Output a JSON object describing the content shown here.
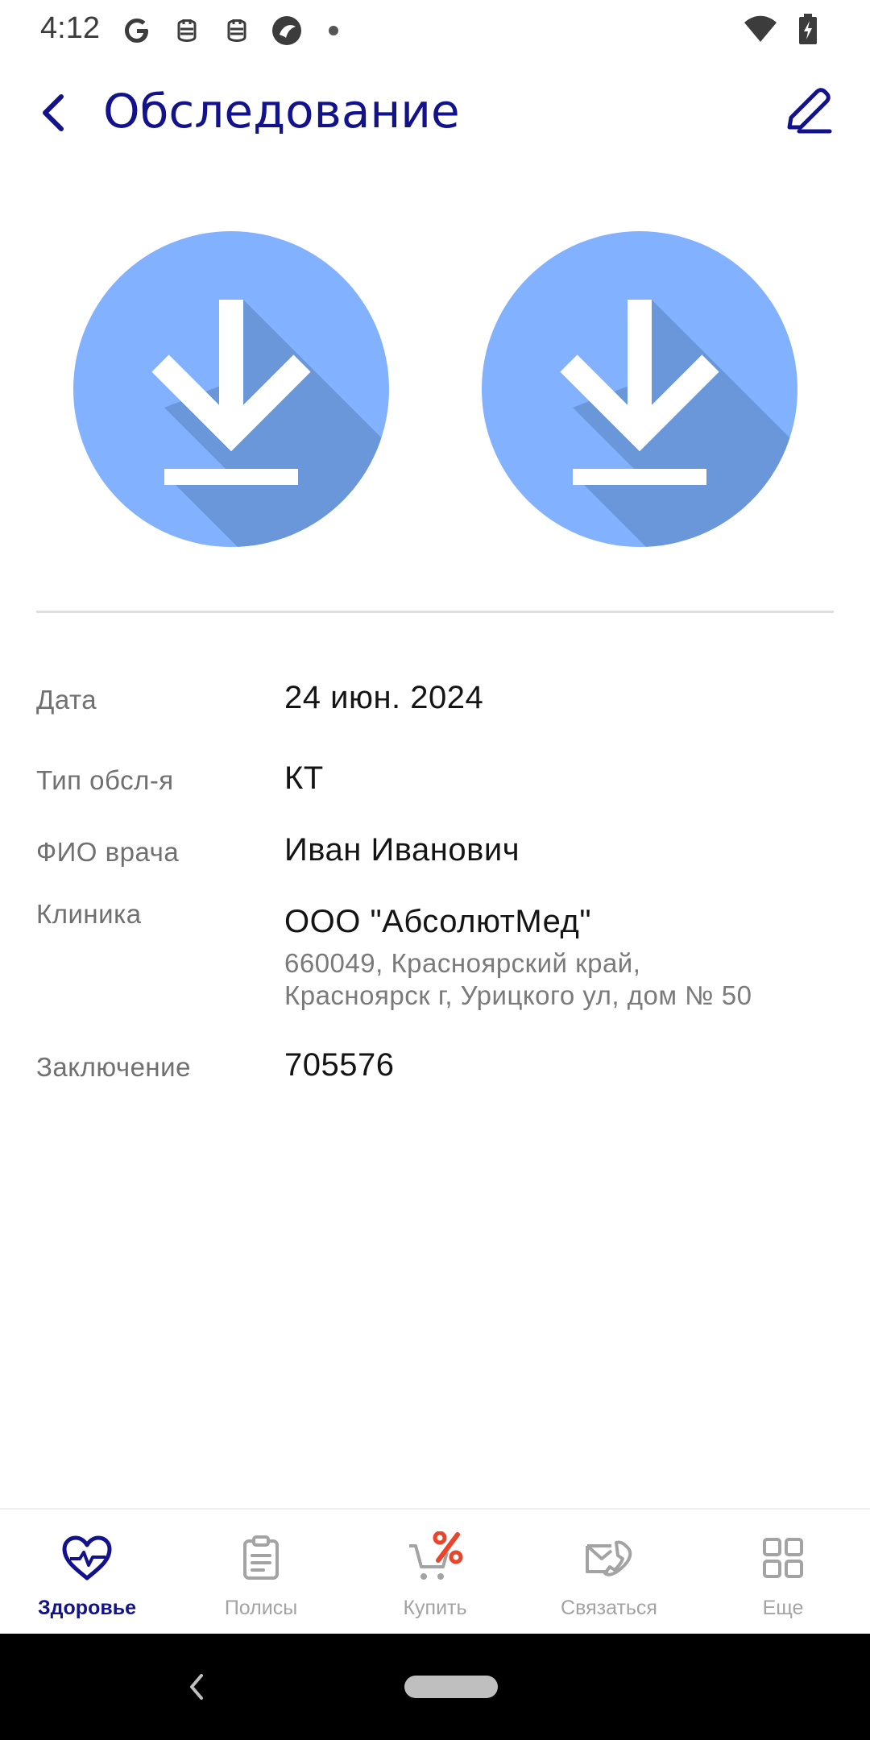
{
  "status_bar": {
    "time": "4:12",
    "left_icons": [
      "google-icon",
      "notification-icon",
      "notification-icon",
      "browser-icon",
      "dot-icon"
    ],
    "right_icons": [
      "wifi-icon",
      "battery-charging-icon"
    ]
  },
  "app_bar": {
    "title": "Обследование",
    "back_icon": "chevron-left-icon",
    "edit_icon": "pencil-icon"
  },
  "attachments": [
    {
      "icon": "download-icon",
      "color": "#82b1ff"
    },
    {
      "icon": "download-icon",
      "color": "#82b1ff"
    }
  ],
  "details": {
    "date": {
      "label": "Дата",
      "value": "24 июн. 2024"
    },
    "type": {
      "label": "Тип обсл-я",
      "value": "КТ"
    },
    "doctor": {
      "label": "ФИО врача",
      "value": "Иван Иванович"
    },
    "clinic": {
      "label": "Клиника",
      "name": "ООО \"АбсолютМед\"",
      "address_line1": "660049, Красноярский край,",
      "address_line2": "Красноярск г, Урицкого ул, дом № 50"
    },
    "conclusion": {
      "label": "Заключение",
      "value": "705576"
    }
  },
  "bottom_nav": [
    {
      "label": "Здоровье",
      "icon": "heart-pulse-icon",
      "active": true
    },
    {
      "label": "Полисы",
      "icon": "clipboard-icon",
      "active": false
    },
    {
      "label": "Купить",
      "icon": "cart-percent-icon",
      "active": false
    },
    {
      "label": "Связаться",
      "icon": "envelope-phone-icon",
      "active": false
    },
    {
      "label": "Еще",
      "icon": "grid-icon",
      "active": false
    }
  ],
  "colors": {
    "primary": "#12128c",
    "attachment": "#82b1ff",
    "accent": "#e8452c",
    "inactive": "#a3a3a3"
  }
}
